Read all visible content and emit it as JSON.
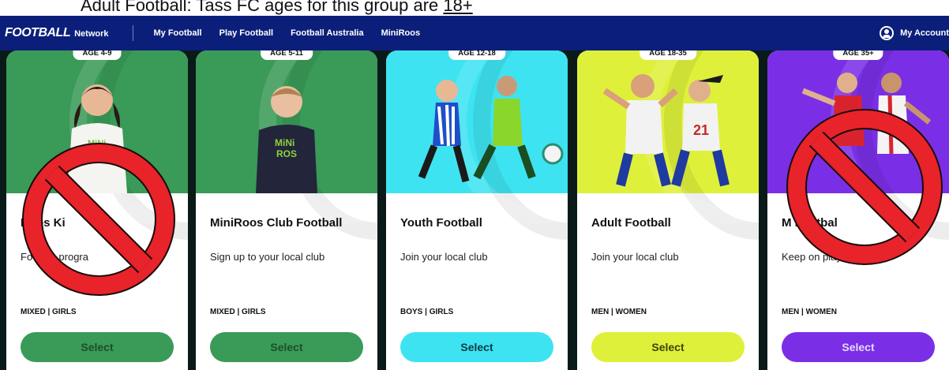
{
  "caption": {
    "text": "Adult Football: Tass FC ages for this group are ",
    "emphasis": "18+"
  },
  "nav": {
    "brand_main": "FOOTBALL",
    "brand_sub": "Network",
    "links": [
      "My Football",
      "Play Football",
      "Football Australia",
      "MiniRoos"
    ],
    "account": "My Account"
  },
  "cards": [
    {
      "age": "AGE 4-9",
      "title": "MiniRoos Kick-Off",
      "visible_title": "Roos Ki",
      "description_visible": "Fo             rodu progra",
      "tags": "MIXED | GIRLS",
      "button": "Select",
      "color": "#3a9a58",
      "button_text_color": "#1f4d2c",
      "crossed_out": true
    },
    {
      "age": "AGE 5-11",
      "title": "MiniRoos Club Football",
      "description_visible": "Sign up to your local club",
      "tags": "MIXED | GIRLS",
      "button": "Select",
      "color": "#3a9a58",
      "button_text_color": "#1f4d2c",
      "crossed_out": false
    },
    {
      "age": "AGE 12-18",
      "title": "Youth Football",
      "description_visible": "Join your local club",
      "tags": "BOYS | GIRLS",
      "button": "Select",
      "color": "#3ee3f2",
      "button_text_color": "#0b3a44",
      "crossed_out": false
    },
    {
      "age": "AGE 18-35",
      "title": "Adult Football",
      "description_visible": "Join your local club",
      "tags": "MEN | WOMEN",
      "button": "Select",
      "color": "#def03a",
      "button_text_color": "#3d4208",
      "crossed_out": false
    },
    {
      "age": "AGE 35+",
      "title": "Masters Football",
      "visible_title": "M         Footbal",
      "description_visible": "Keep on playing",
      "tags": "MEN | WOMEN",
      "button": "Select",
      "color": "#7a2fe6",
      "button_text_color": "#e6d8ff",
      "crossed_out": true
    }
  ],
  "colors": {
    "nav_bg": "#0b1f7a",
    "prohibition_red": "#e8232a"
  }
}
